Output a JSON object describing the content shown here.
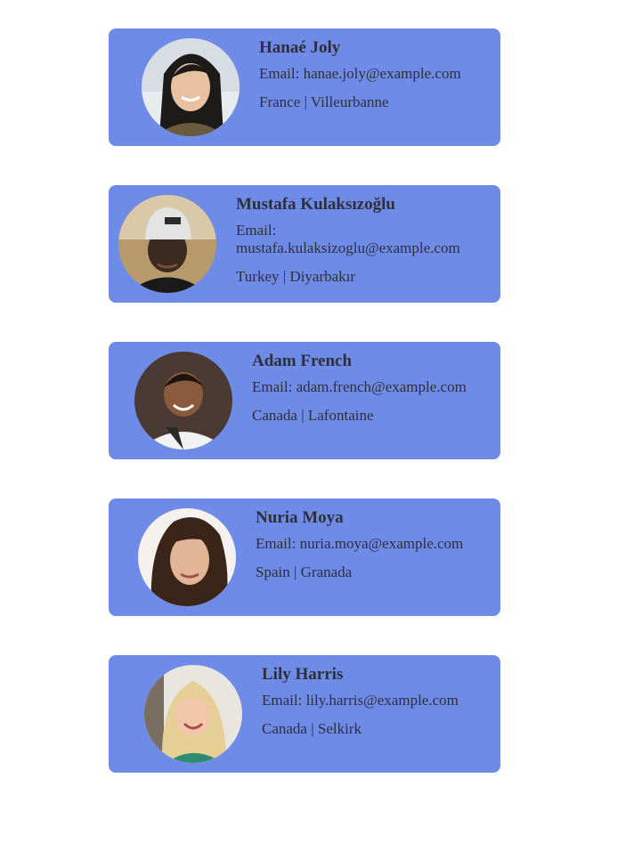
{
  "colors": {
    "card_background": "#6f8be8",
    "text": "#2f2f3a"
  },
  "users": [
    {
      "name": "Hanaé Joly",
      "email_label": "Email: hanae.joly@example.com",
      "location": "France | Villeurbanne",
      "avatar_icon": "user-photo-hanae-joly"
    },
    {
      "name": "Mustafa Kulaksızoğlu",
      "email_label": "Email: mustafa.kulaksizoglu@example.com",
      "location": "Turkey | Diyarbakır",
      "avatar_icon": "user-photo-mustafa-kulaksizoglu"
    },
    {
      "name": "Adam French",
      "email_label": "Email: adam.french@example.com",
      "location": "Canada | Lafontaine",
      "avatar_icon": "user-photo-adam-french"
    },
    {
      "name": "Nuria Moya",
      "email_label": "Email: nuria.moya@example.com",
      "location": "Spain | Granada",
      "avatar_icon": "user-photo-nuria-moya"
    },
    {
      "name": "Lily Harris",
      "email_label": "Email: lily.harris@example.com",
      "location": "Canada | Selkirk",
      "avatar_icon": "user-photo-lily-harris"
    }
  ]
}
